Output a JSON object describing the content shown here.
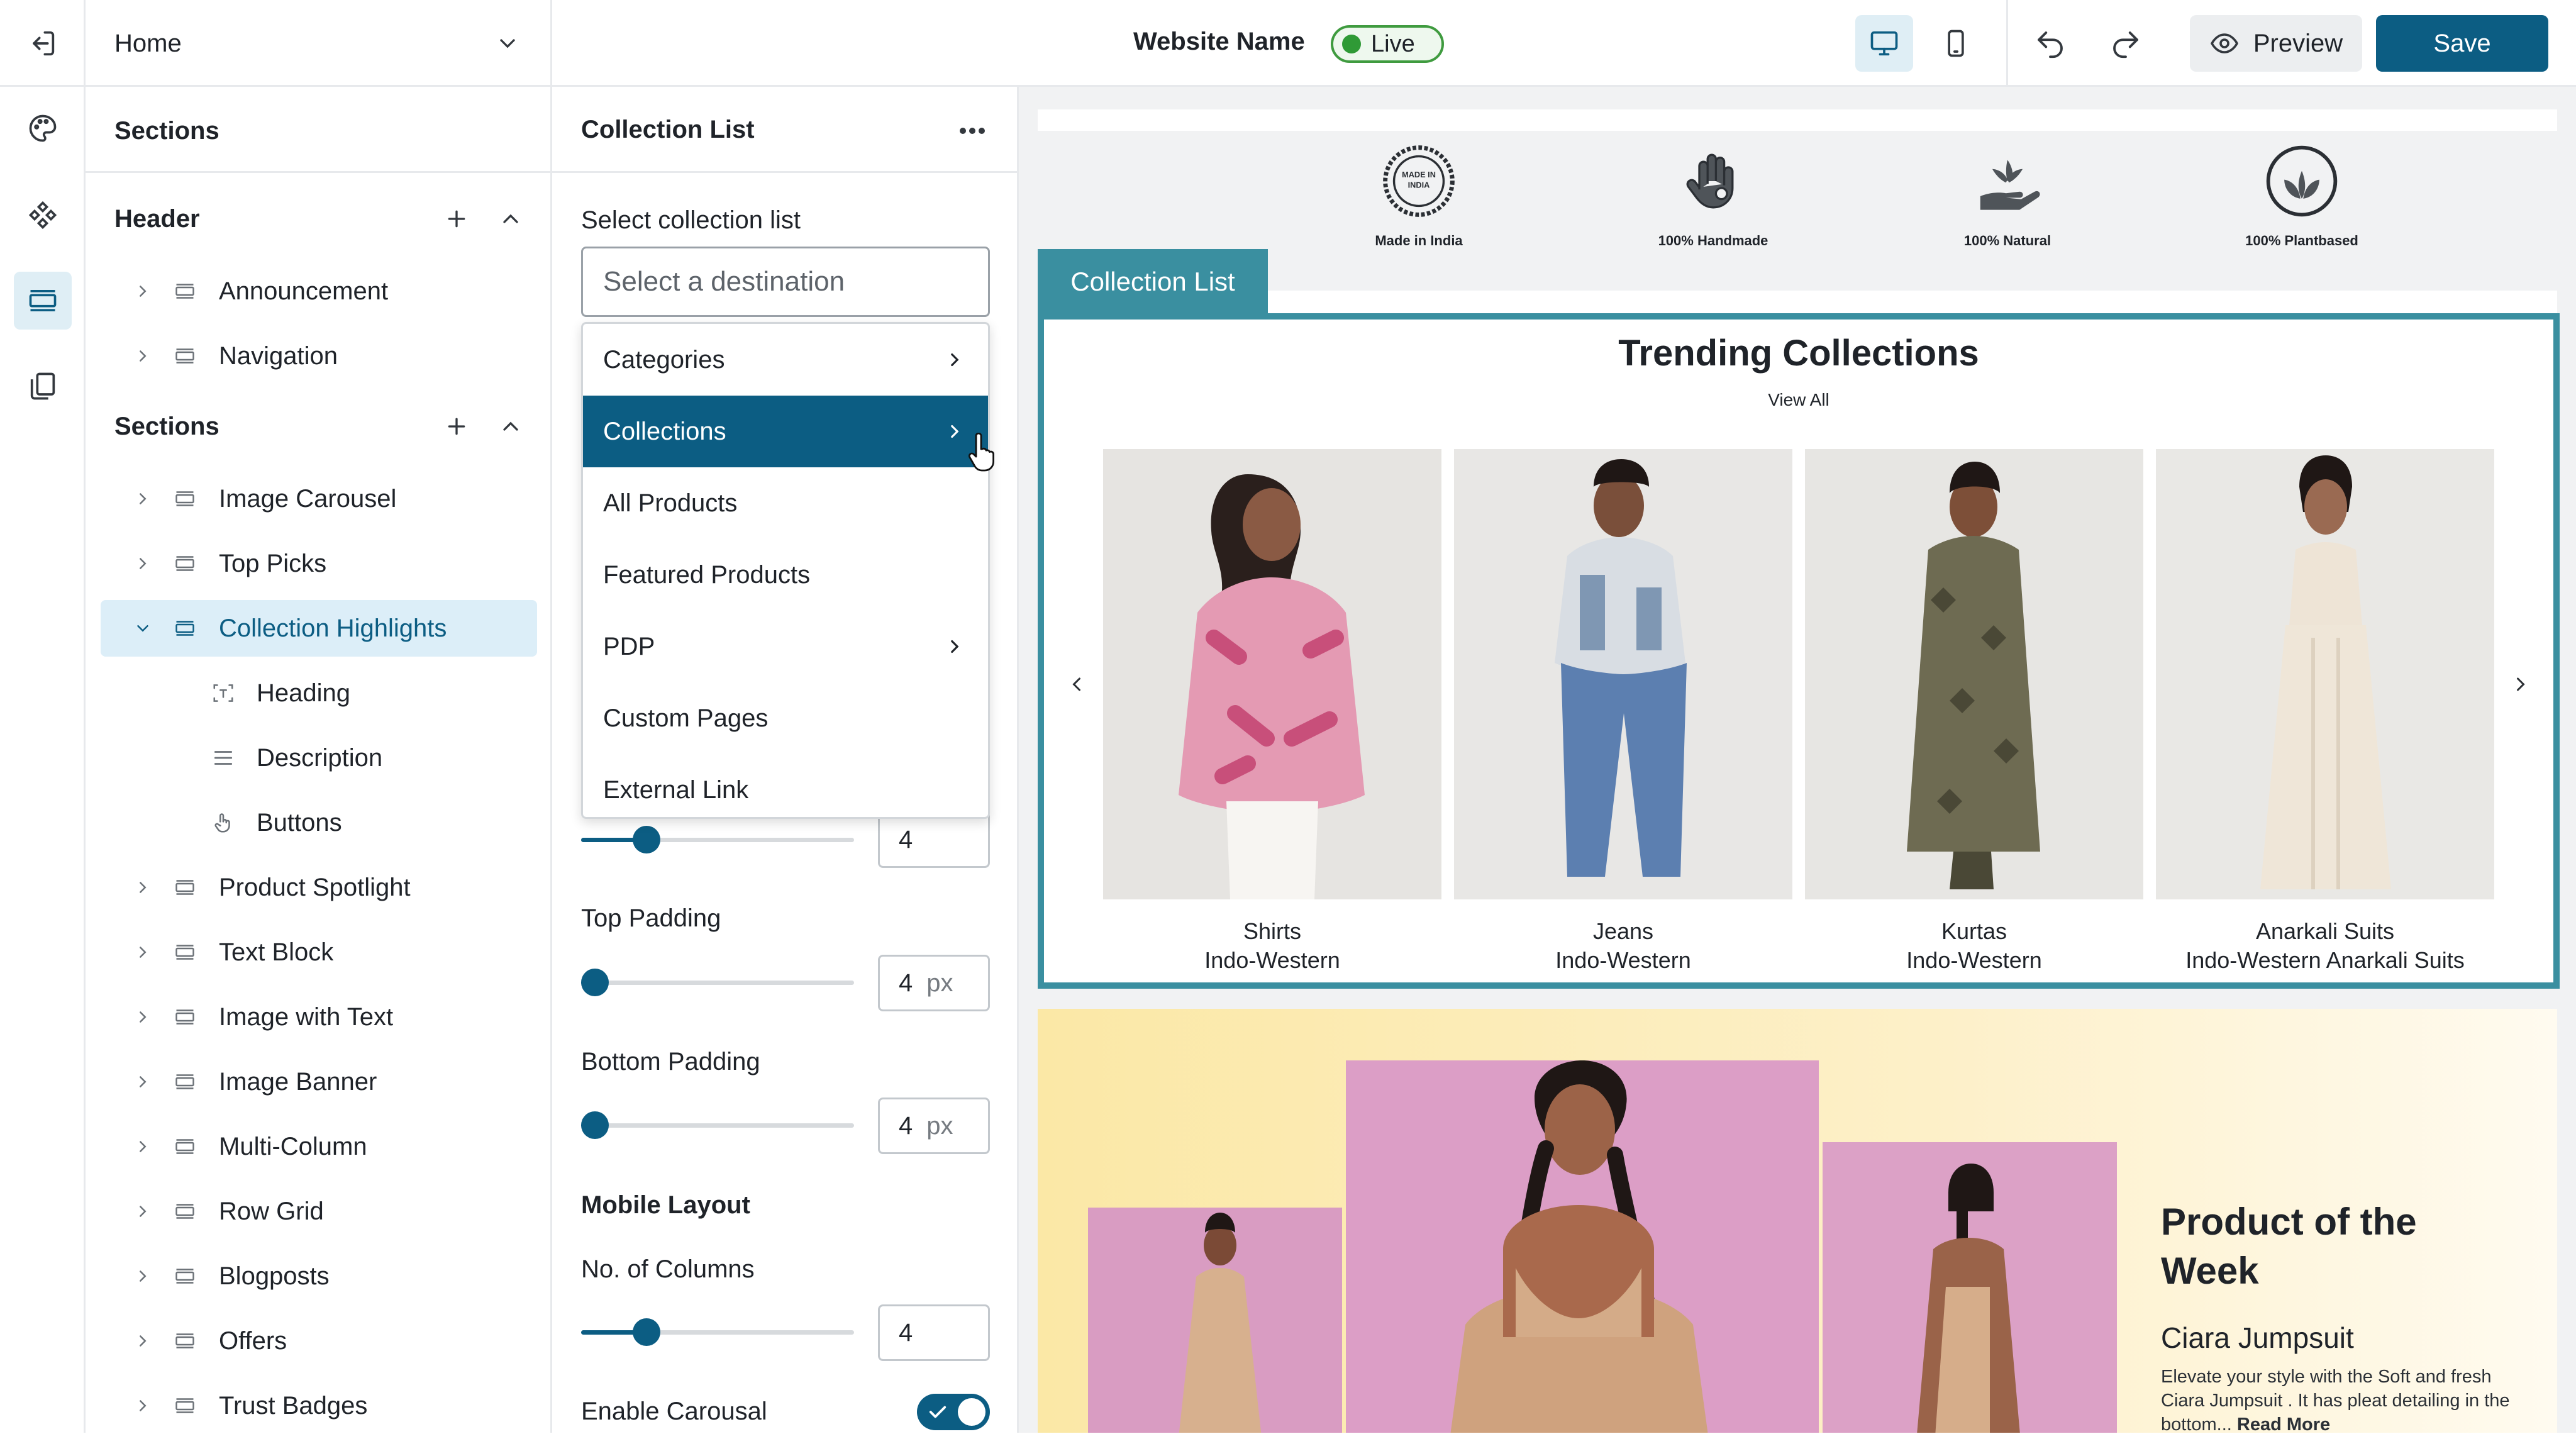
{
  "topbar": {
    "page_select": "Home",
    "site_name": "Website Name",
    "status": "Live",
    "preview_label": "Preview",
    "save_label": "Save"
  },
  "sections_panel": {
    "title": "Sections",
    "header_group": "Header",
    "header_items": [
      {
        "label": "Announcement"
      },
      {
        "label": "Navigation"
      }
    ],
    "sections_group": "Sections",
    "section_items": [
      {
        "label": "Image Carousel"
      },
      {
        "label": "Top Picks"
      },
      {
        "label": "Collection Highlights"
      },
      {
        "label": "Product Spotlight"
      },
      {
        "label": "Text Block"
      },
      {
        "label": "Image with Text"
      },
      {
        "label": "Image Banner"
      },
      {
        "label": "Multi-Column"
      },
      {
        "label": "Row Grid"
      },
      {
        "label": "Blogposts"
      },
      {
        "label": "Offers"
      },
      {
        "label": "Trust Badges"
      }
    ],
    "children": [
      {
        "label": "Heading"
      },
      {
        "label": "Description"
      },
      {
        "label": "Buttons"
      }
    ]
  },
  "settings": {
    "title": "Collection List",
    "select_label": "Select collection list",
    "placeholder": "Select a destination",
    "dropdown": [
      {
        "label": "Categories",
        "has_submenu": true
      },
      {
        "label": "Collections",
        "has_submenu": true
      },
      {
        "label": "All Products",
        "has_submenu": false
      },
      {
        "label": "Featured Products",
        "has_submenu": false
      },
      {
        "label": "PDP",
        "has_submenu": true
      },
      {
        "label": "Custom Pages",
        "has_submenu": false
      },
      {
        "label": "External Link",
        "has_submenu": false
      }
    ],
    "desktop_columns": "4",
    "top_padding_label": "Top Padding",
    "top_padding": "4",
    "bottom_padding_label": "Bottom Padding",
    "bottom_padding": "4",
    "unit": "px",
    "mobile_layout_label": "Mobile Layout",
    "mobile_columns_label": "No. of Columns",
    "mobile_columns": "4",
    "carousel_label": "Enable Carousal",
    "carousel_enabled": true
  },
  "preview": {
    "badges": [
      {
        "label": "Made in India",
        "seal_text": "MADE IN INDIA"
      },
      {
        "label": "100% Handmade"
      },
      {
        "label": "100% Natural"
      },
      {
        "label": "100% Plantbased"
      }
    ],
    "collection_tab": "Collection List",
    "trending_title": "Trending Collections",
    "view_all": "View All",
    "products": [
      {
        "name": "Shirts",
        "category": "Indo-Western"
      },
      {
        "name": "Jeans",
        "category": "Indo-Western"
      },
      {
        "name": "Kurtas",
        "category": "Indo-Western"
      },
      {
        "name": "Anarkali Suits",
        "category": "Indo-Western Anarkali Suits"
      }
    ],
    "pow_title": "Product of the Week",
    "pow_product": "Ciara Jumpsuit",
    "pow_desc": "Elevate your style with the Soft and fresh Ciara Jumpsuit . It has pleat detailing in the bottom...",
    "pow_read_more": "Read More"
  },
  "colors": {
    "accent": "#0c5d83",
    "live_green": "#2f9a36",
    "frame_teal": "#3a8fa0"
  }
}
